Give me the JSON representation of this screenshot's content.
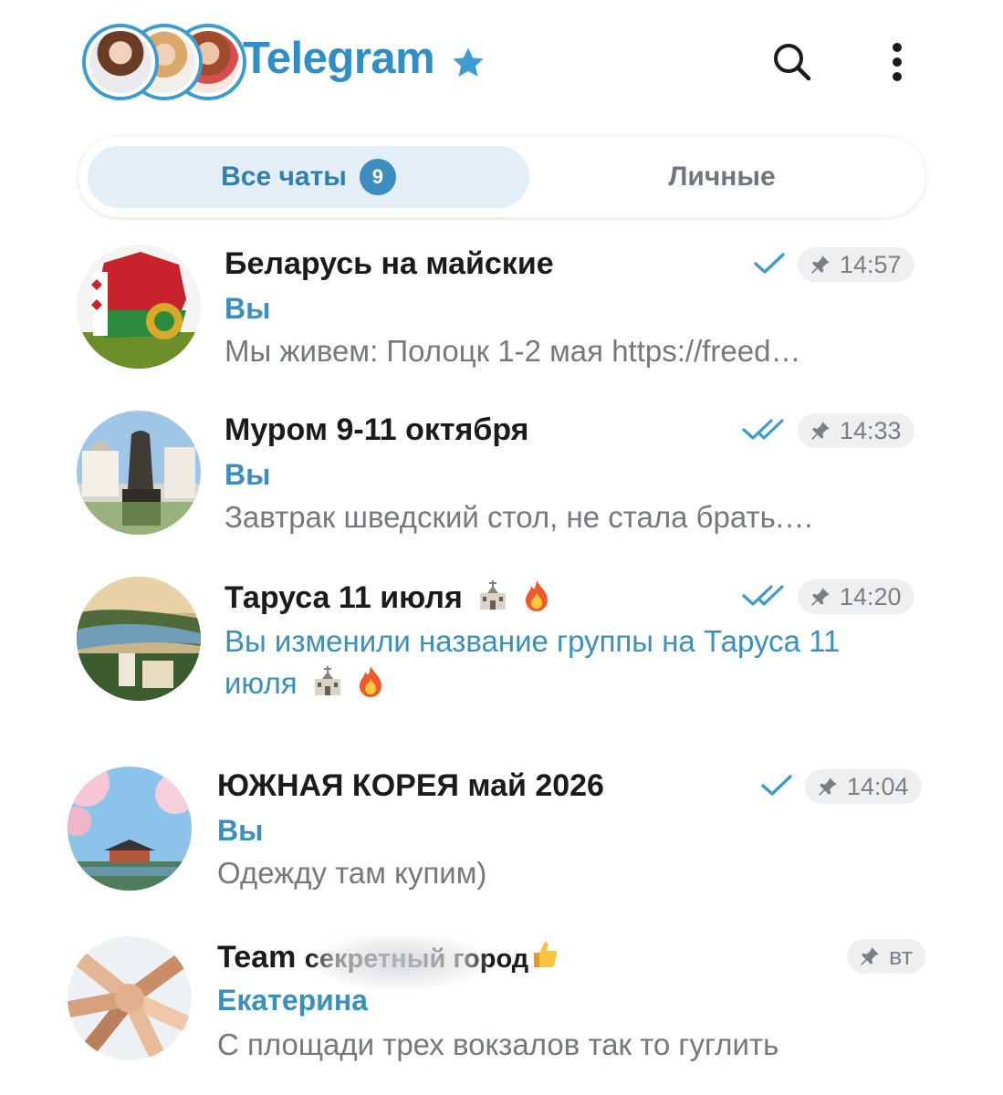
{
  "header": {
    "title": "Telegram",
    "icons": {
      "premium": "premium-star-icon",
      "search": "search-icon",
      "menu": "more-vertical-icon"
    }
  },
  "tabs": [
    {
      "label": "Все чаты",
      "count": "9",
      "active": true
    },
    {
      "label": "Личные",
      "active": false
    }
  ],
  "chats": [
    {
      "name": "Беларусь на майские",
      "sender": "Вы",
      "preview": "Мы живем:  Полоцк 1-2 мая https://freed…",
      "time": "14:57",
      "pinned": true,
      "status": "sent"
    },
    {
      "name": "Муром 9-11 октября",
      "sender": "Вы",
      "preview": "Завтрак шведский стол, не стала брать.…",
      "time": "14:33",
      "pinned": true,
      "status": "read"
    },
    {
      "name": "Таруса 11 июля",
      "name_emojis": [
        "church",
        "fire"
      ],
      "service_line1": "Вы изменили название группы на Таруса 11",
      "service_line2": "июля",
      "time": "14:20",
      "pinned": true,
      "status": "read"
    },
    {
      "name": "ЮЖНАЯ КОРЕЯ май 2026",
      "sender": "Вы",
      "preview": "Одежду там купим)",
      "time": "14:04",
      "pinned": true,
      "status": "sent"
    },
    {
      "name_part1": "Team",
      "name_part2": "секретный город",
      "name_emoji": "thumbs-up",
      "sender": "Екатерина",
      "preview": "С площади трех вокзалов так то гуглить",
      "time": "вт",
      "pinned": true,
      "status": "none"
    }
  ],
  "colors": {
    "accent": "#2f8ec5",
    "sender": "#3a8fbd",
    "tab_active_bg": "#e4eef6",
    "check": "#3d9bd0"
  }
}
